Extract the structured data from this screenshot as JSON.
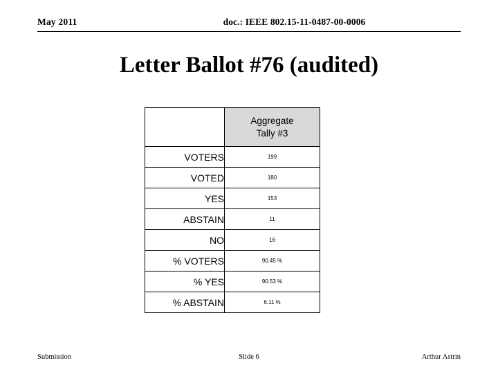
{
  "header": {
    "date": "May 2011",
    "doc_id": "doc.: IEEE 802.15-11-0487-00-0006"
  },
  "title": "Letter Ballot #76 (audited)",
  "table": {
    "corner_label": "",
    "column_header": "Aggregate Tally #3",
    "column_header_line1": "Aggregate",
    "column_header_line2": "Tally #3",
    "rows": [
      {
        "label": "VOTERS",
        "value": "199"
      },
      {
        "label": "VOTED",
        "value": "180"
      },
      {
        "label": "YES",
        "value": "153"
      },
      {
        "label": "ABSTAIN",
        "value": "11"
      },
      {
        "label": "NO",
        "value": "16"
      },
      {
        "label": "% VOTERS",
        "value": "90.45 %"
      },
      {
        "label": "% YES",
        "value": "90.53 %"
      },
      {
        "label": "% ABSTAIN",
        "value": "6.11 %"
      }
    ]
  },
  "footer": {
    "left": "Submission",
    "center": "Slide 6",
    "right": "Arthur Astrin"
  }
}
